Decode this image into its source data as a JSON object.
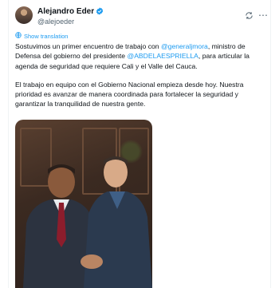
{
  "author": {
    "name": "Alejandro Eder",
    "handle": "@alejoeder"
  },
  "translate_label": "Show translation",
  "tweet": {
    "p1_a": "Sostuvimos un primer encuentro de trabajo con ",
    "mention1": "@generaljmora",
    "p1_b": ", ministro de Defensa del gobierno del presidente ",
    "mention2": "@ABDELAESPRIELLA",
    "p1_c": ", para articular la agenda de seguridad que requiere Cali y el Valle del Cauca.",
    "p2": "El trabajo en equipo con el Gobierno Nacional empieza desde hoy. Nuestra prioridad es avanzar de manera coordinada para fortalecer la seguridad y garantizar la tranquilidad de nuestra gente."
  },
  "colors": {
    "link": "#1d9bf0",
    "verified": "#1d9bf0",
    "text": "#0f1419",
    "muted": "#536471"
  },
  "icons": [
    "verified-badge-icon",
    "grok-icon",
    "more-icon",
    "translate-icon"
  ]
}
